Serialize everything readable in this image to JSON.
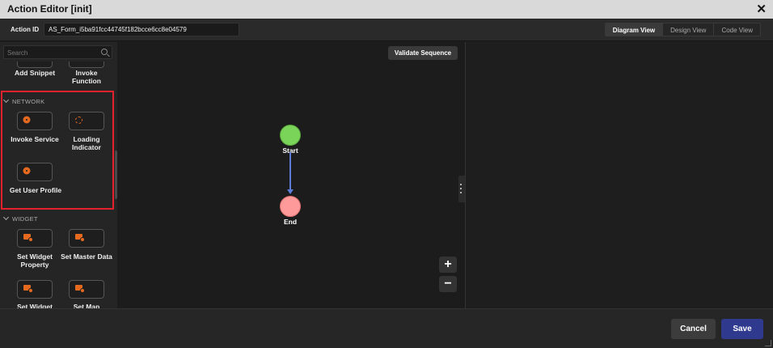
{
  "window": {
    "title": "Action Editor [init]",
    "close_glyph": "✕"
  },
  "topbar": {
    "action_id_label": "Action ID",
    "action_id_value": "AS_Form_i5ba91fcc44745f182bcce6cc8e04579",
    "views": [
      "Diagram View",
      "Design View",
      "Code View"
    ],
    "active_view": "Diagram View"
  },
  "sidebar": {
    "search_placeholder": "Search",
    "items_top": [
      "Add Snippet",
      "Invoke Function"
    ],
    "sections": [
      {
        "name": "NETWORK",
        "items": [
          "Invoke Service",
          "Loading Indicator",
          "Get User Profile"
        ]
      },
      {
        "name": "WIDGET",
        "items": [
          "Set Widget Property",
          "Set Master Data",
          "Set Widget",
          "Set Map"
        ]
      }
    ],
    "highlight_color": "#e3222e"
  },
  "canvas": {
    "validate_label": "Validate Sequence",
    "nodes": [
      {
        "label": "Start",
        "color": "#7bd45a"
      },
      {
        "label": "End",
        "color": "#ff9a9a"
      }
    ],
    "edge_color": "#5d7cd8",
    "zoom_in": "+",
    "zoom_out": "−"
  },
  "footer": {
    "cancel_label": "Cancel",
    "save_label": "Save",
    "save_color": "#2f3a8f"
  }
}
